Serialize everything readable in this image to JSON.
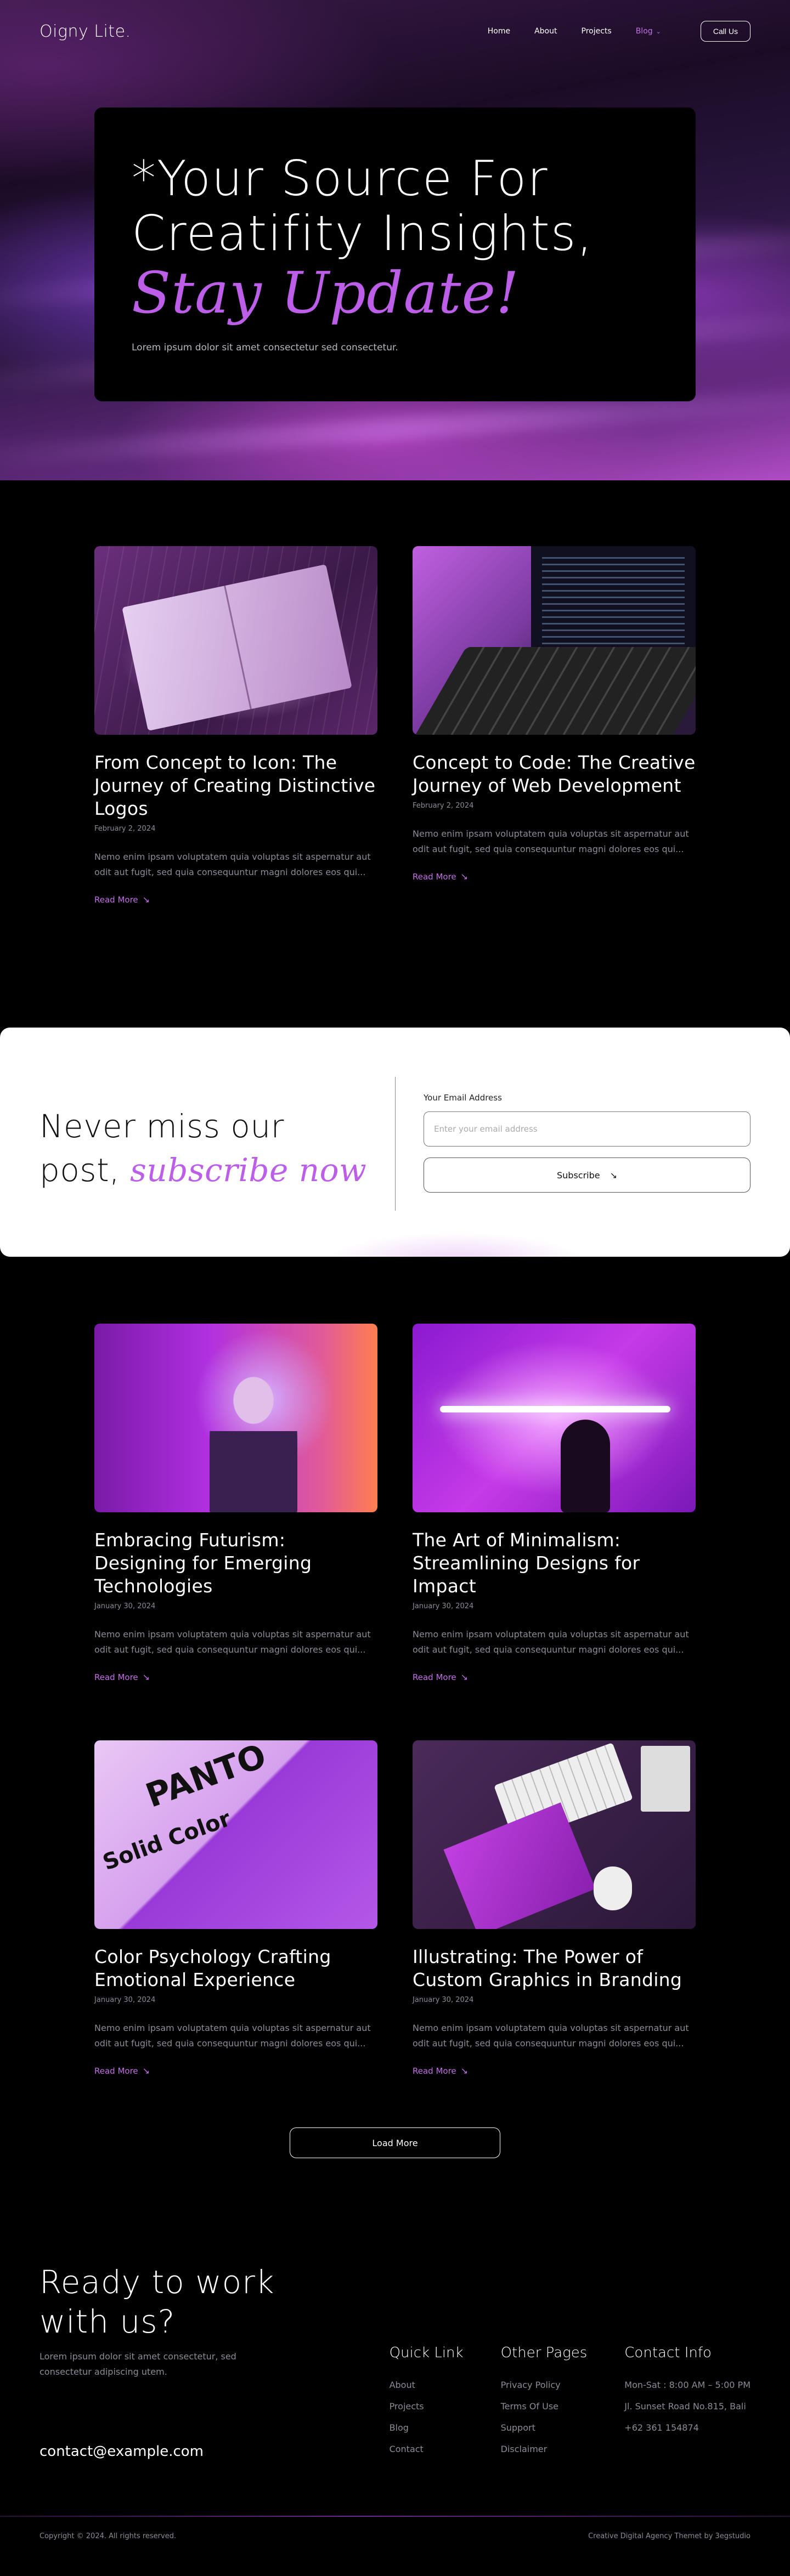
{
  "nav": {
    "logo": "Oigny Lite.",
    "links": [
      {
        "label": "Home"
      },
      {
        "label": "About"
      },
      {
        "label": "Projects"
      },
      {
        "label": "Blog"
      }
    ],
    "cta": "Call Us"
  },
  "hero": {
    "title_line1": "*Your Source For",
    "title_line2": "Creatifity Insights,",
    "title_accent": "Stay Update!",
    "subtitle": "Lorem ipsum dolor sit amet consectetur sed consectetur."
  },
  "posts_top": [
    {
      "title": "From Concept to Icon: The Journey of Creating Distinctive Logos",
      "date": "February 2, 2024",
      "excerpt": "Nemo enim ipsam voluptatem quia voluptas sit aspernatur aut odit aut fugit, sed quia consequuntur magni dolores eos qui...",
      "read_more": "Read More"
    },
    {
      "title": "Concept to Code: The Creative Journey of Web Development",
      "date": "February 2, 2024",
      "excerpt": "Nemo enim ipsam voluptatem quia voluptas sit aspernatur aut odit aut fugit, sed quia consequuntur magni dolores eos qui...",
      "read_more": "Read More"
    }
  ],
  "subscribe": {
    "title_line1": "Never miss our",
    "title_line2": "post,",
    "title_accent": "subscribe now",
    "email_label": "Your Email Address",
    "email_placeholder": "Enter your email address",
    "button": "Subscribe"
  },
  "posts_bottom": [
    {
      "title": "Embracing Futurism: Designing for Emerging Technologies",
      "date": "January 30, 2024",
      "excerpt": "Nemo enim ipsam voluptatem quia voluptas sit aspernatur aut odit aut fugit, sed quia consequuntur magni dolores eos qui...",
      "read_more": "Read More"
    },
    {
      "title": "The Art of Minimalism: Streamlining Designs for Impact",
      "date": "January 30, 2024",
      "excerpt": "Nemo enim ipsam voluptatem quia voluptas sit aspernatur aut odit aut fugit, sed quia consequuntur magni dolores eos qui...",
      "read_more": "Read More"
    },
    {
      "title": "Color Psychology Crafting Emotional Experience",
      "date": "January 30, 2024",
      "excerpt": "Nemo enim ipsam voluptatem quia voluptas sit aspernatur aut odit aut fugit, sed quia consequuntur magni dolores eos qui...",
      "read_more": "Read More"
    },
    {
      "title": "Illustrating: The Power of Custom Graphics in Branding",
      "date": "January 30, 2024",
      "excerpt": "Nemo enim ipsam voluptatem quia voluptas sit aspernatur aut odit aut fugit, sed quia consequuntur magni dolores eos qui...",
      "read_more": "Read More"
    }
  ],
  "image_text": {
    "pantone": "PANTO",
    "solid_color": "Solid Color"
  },
  "load_more": "Load More",
  "footer": {
    "title_line1": "Ready to work",
    "title_line2": "with us?",
    "desc": "Lorem ipsum dolor sit amet consectetur, sed consectetur adipiscing utem.",
    "email": "contact@example.com",
    "quick_links": {
      "heading": "Quick Link",
      "items": [
        "About",
        "Projects",
        "Blog",
        "Contact"
      ]
    },
    "other_pages": {
      "heading": "Other Pages",
      "items": [
        "Privacy Policy",
        "Terms Of Use",
        "Support",
        "Disclaimer"
      ]
    },
    "contact_info": {
      "heading": "Contact Info",
      "items": [
        "Mon-Sat : 8:00 AM – 5:00 PM",
        "Jl. Sunset Road No.815, Bali",
        "+62 361 154874"
      ]
    },
    "copyright": "Copyright © 2024. All rights reserved.",
    "credit": "Creative Digital Agency Themet by 3egstudio"
  },
  "colors": {
    "accent": "#bd5ee8",
    "background": "#000000",
    "muted_text": "#8e8a96"
  }
}
